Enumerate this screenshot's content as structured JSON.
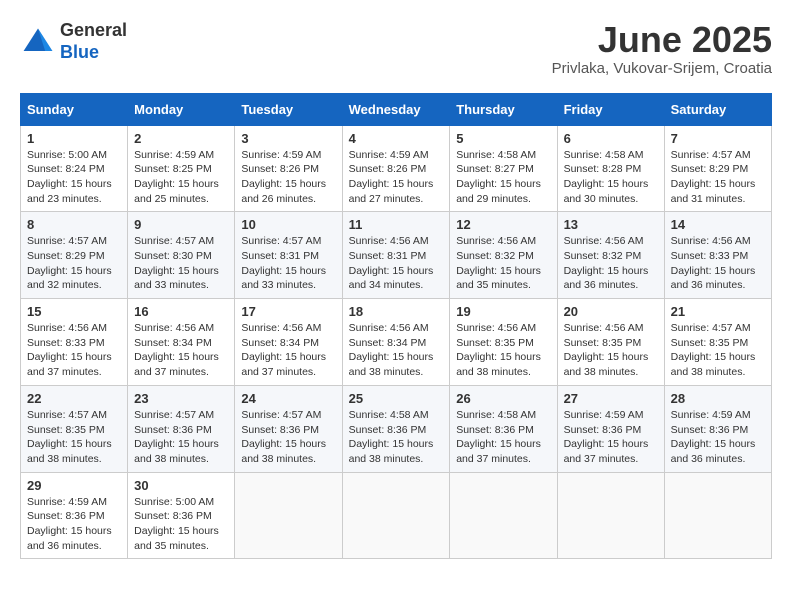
{
  "header": {
    "logo_general": "General",
    "logo_blue": "Blue",
    "month_title": "June 2025",
    "location": "Privlaka, Vukovar-Srijem, Croatia"
  },
  "calendar": {
    "headers": [
      "Sunday",
      "Monday",
      "Tuesday",
      "Wednesday",
      "Thursday",
      "Friday",
      "Saturday"
    ],
    "weeks": [
      [
        null,
        {
          "day": "2",
          "sunrise": "4:59 AM",
          "sunset": "8:25 PM",
          "daylight": "15 hours and 25 minutes."
        },
        {
          "day": "3",
          "sunrise": "4:59 AM",
          "sunset": "8:26 PM",
          "daylight": "15 hours and 26 minutes."
        },
        {
          "day": "4",
          "sunrise": "4:59 AM",
          "sunset": "8:26 PM",
          "daylight": "15 hours and 27 minutes."
        },
        {
          "day": "5",
          "sunrise": "4:58 AM",
          "sunset": "8:27 PM",
          "daylight": "15 hours and 29 minutes."
        },
        {
          "day": "6",
          "sunrise": "4:58 AM",
          "sunset": "8:28 PM",
          "daylight": "15 hours and 30 minutes."
        },
        {
          "day": "7",
          "sunrise": "4:57 AM",
          "sunset": "8:29 PM",
          "daylight": "15 hours and 31 minutes."
        }
      ],
      [
        {
          "day": "8",
          "sunrise": "4:57 AM",
          "sunset": "8:29 PM",
          "daylight": "15 hours and 32 minutes."
        },
        {
          "day": "9",
          "sunrise": "4:57 AM",
          "sunset": "8:30 PM",
          "daylight": "15 hours and 33 minutes."
        },
        {
          "day": "10",
          "sunrise": "4:57 AM",
          "sunset": "8:31 PM",
          "daylight": "15 hours and 33 minutes."
        },
        {
          "day": "11",
          "sunrise": "4:56 AM",
          "sunset": "8:31 PM",
          "daylight": "15 hours and 34 minutes."
        },
        {
          "day": "12",
          "sunrise": "4:56 AM",
          "sunset": "8:32 PM",
          "daylight": "15 hours and 35 minutes."
        },
        {
          "day": "13",
          "sunrise": "4:56 AM",
          "sunset": "8:32 PM",
          "daylight": "15 hours and 36 minutes."
        },
        {
          "day": "14",
          "sunrise": "4:56 AM",
          "sunset": "8:33 PM",
          "daylight": "15 hours and 36 minutes."
        }
      ],
      [
        {
          "day": "15",
          "sunrise": "4:56 AM",
          "sunset": "8:33 PM",
          "daylight": "15 hours and 37 minutes."
        },
        {
          "day": "16",
          "sunrise": "4:56 AM",
          "sunset": "8:34 PM",
          "daylight": "15 hours and 37 minutes."
        },
        {
          "day": "17",
          "sunrise": "4:56 AM",
          "sunset": "8:34 PM",
          "daylight": "15 hours and 37 minutes."
        },
        {
          "day": "18",
          "sunrise": "4:56 AM",
          "sunset": "8:34 PM",
          "daylight": "15 hours and 38 minutes."
        },
        {
          "day": "19",
          "sunrise": "4:56 AM",
          "sunset": "8:35 PM",
          "daylight": "15 hours and 38 minutes."
        },
        {
          "day": "20",
          "sunrise": "4:56 AM",
          "sunset": "8:35 PM",
          "daylight": "15 hours and 38 minutes."
        },
        {
          "day": "21",
          "sunrise": "4:57 AM",
          "sunset": "8:35 PM",
          "daylight": "15 hours and 38 minutes."
        }
      ],
      [
        {
          "day": "22",
          "sunrise": "4:57 AM",
          "sunset": "8:35 PM",
          "daylight": "15 hours and 38 minutes."
        },
        {
          "day": "23",
          "sunrise": "4:57 AM",
          "sunset": "8:36 PM",
          "daylight": "15 hours and 38 minutes."
        },
        {
          "day": "24",
          "sunrise": "4:57 AM",
          "sunset": "8:36 PM",
          "daylight": "15 hours and 38 minutes."
        },
        {
          "day": "25",
          "sunrise": "4:58 AM",
          "sunset": "8:36 PM",
          "daylight": "15 hours and 38 minutes."
        },
        {
          "day": "26",
          "sunrise": "4:58 AM",
          "sunset": "8:36 PM",
          "daylight": "15 hours and 37 minutes."
        },
        {
          "day": "27",
          "sunrise": "4:59 AM",
          "sunset": "8:36 PM",
          "daylight": "15 hours and 37 minutes."
        },
        {
          "day": "28",
          "sunrise": "4:59 AM",
          "sunset": "8:36 PM",
          "daylight": "15 hours and 36 minutes."
        }
      ],
      [
        {
          "day": "29",
          "sunrise": "4:59 AM",
          "sunset": "8:36 PM",
          "daylight": "15 hours and 36 minutes."
        },
        {
          "day": "30",
          "sunrise": "5:00 AM",
          "sunset": "8:36 PM",
          "daylight": "15 hours and 35 minutes."
        },
        null,
        null,
        null,
        null,
        null
      ]
    ],
    "first_week_day1": {
      "day": "1",
      "sunrise": "5:00 AM",
      "sunset": "8:24 PM",
      "daylight": "15 hours and 23 minutes."
    }
  }
}
